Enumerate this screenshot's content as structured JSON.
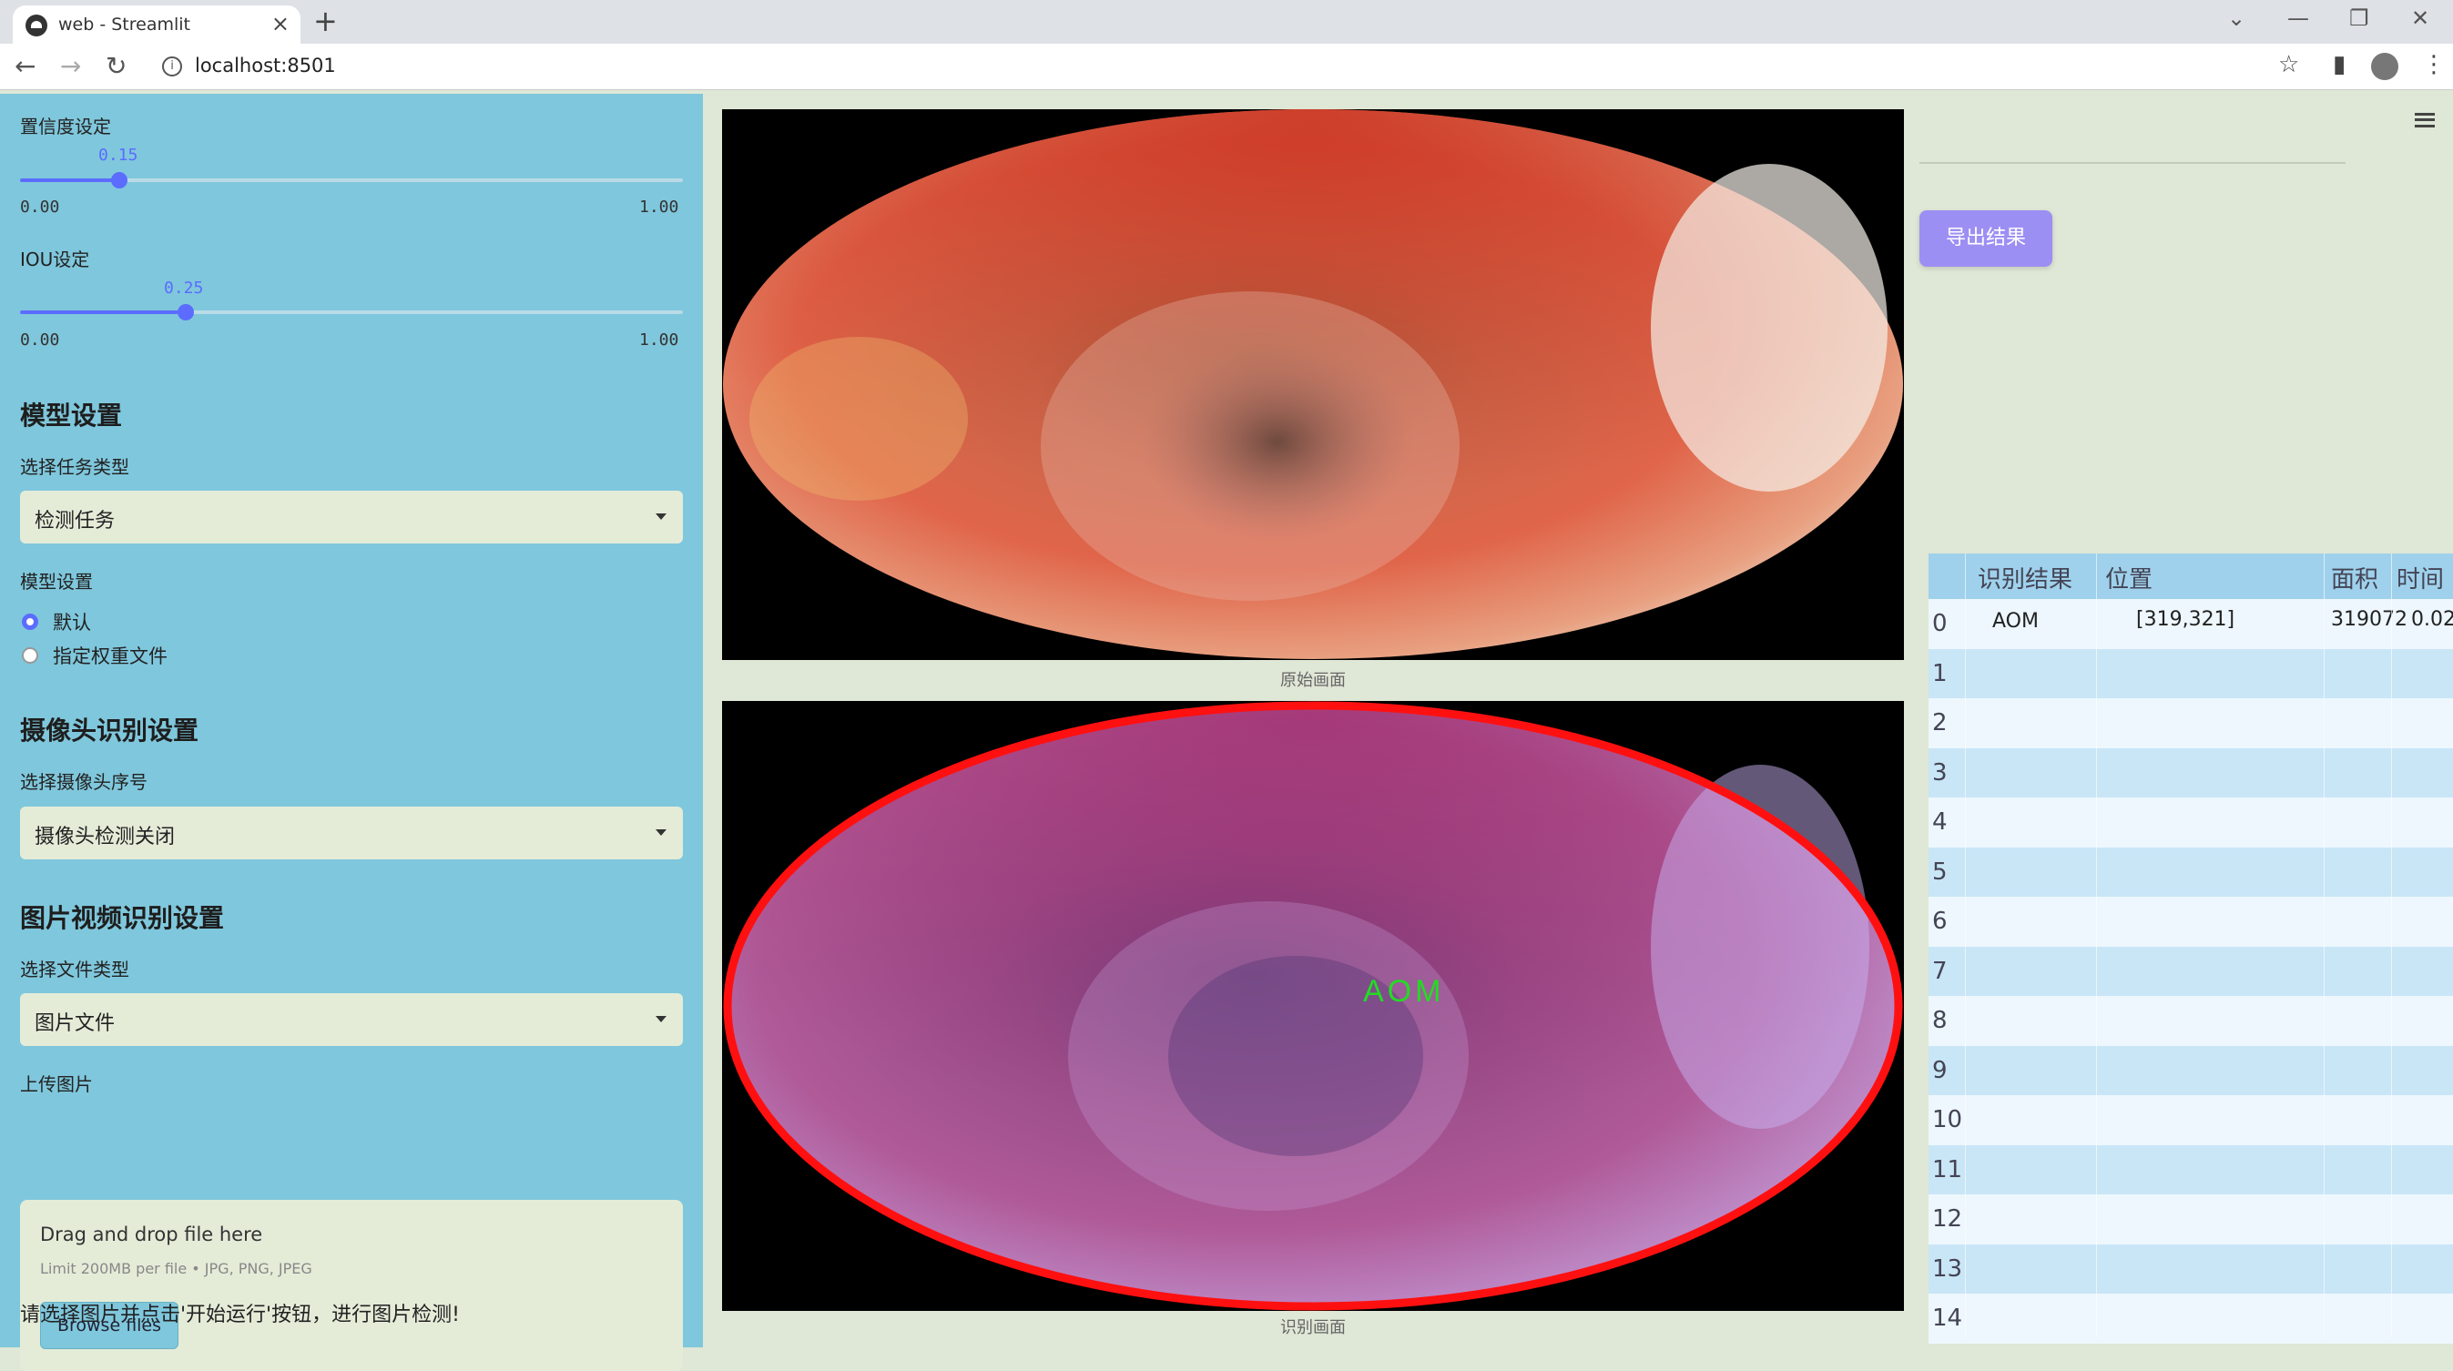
{
  "browser": {
    "tab_title": "web - Streamlit",
    "url": "localhost:8501"
  },
  "sidebar": {
    "confidence": {
      "label": "置信度设定",
      "value": "0.15",
      "min": "0.00",
      "max": "1.00",
      "fraction": 0.15
    },
    "iou": {
      "label": "IOU设定",
      "value": "0.25",
      "min": "0.00",
      "max": "1.00",
      "fraction": 0.25
    },
    "model_header": "模型设置",
    "task_label": "选择任务类型",
    "task_value": "检测任务",
    "model_label": "模型设置",
    "radio_default": "默认",
    "radio_custom": "指定权重文件",
    "camera_header": "摄像头识别设置",
    "camera_label": "选择摄像头序号",
    "camera_value": "摄像头检测关闭",
    "media_header": "图片视频识别设置",
    "filetype_label": "选择文件类型",
    "filetype_value": "图片文件",
    "upload_label": "上传图片",
    "drop_title": "Drag and drop file here",
    "drop_limit": "Limit 200MB per file • JPG, PNG, JPEG",
    "browse_label": "Browse files",
    "hint": "请选择图片并点击'开始运行'按钮，进行图片检测!"
  },
  "main": {
    "original_caption": "原始画面",
    "result_caption": "识别画面",
    "detection_label": "AOM"
  },
  "right": {
    "export_label": "导出结果",
    "table": {
      "headers": [
        "识别结果",
        "位置",
        "面积",
        "时间"
      ],
      "rows": [
        {
          "idx": "0",
          "result": "AOM",
          "position": "[319,321]",
          "area": "319072",
          "time": "0.02"
        },
        {
          "idx": "1"
        },
        {
          "idx": "2"
        },
        {
          "idx": "3"
        },
        {
          "idx": "4"
        },
        {
          "idx": "5"
        },
        {
          "idx": "6"
        },
        {
          "idx": "7"
        },
        {
          "idx": "8"
        },
        {
          "idx": "9"
        },
        {
          "idx": "10"
        },
        {
          "idx": "11"
        },
        {
          "idx": "12"
        },
        {
          "idx": "13"
        },
        {
          "idx": "14"
        }
      ]
    }
  },
  "colors": {
    "sidebar_bg": "#7fc7dc",
    "accent": "#5b6cff",
    "export_btn": "#9c8ff3",
    "detection_box": "#ff1010",
    "detection_text": "#22dd22"
  }
}
